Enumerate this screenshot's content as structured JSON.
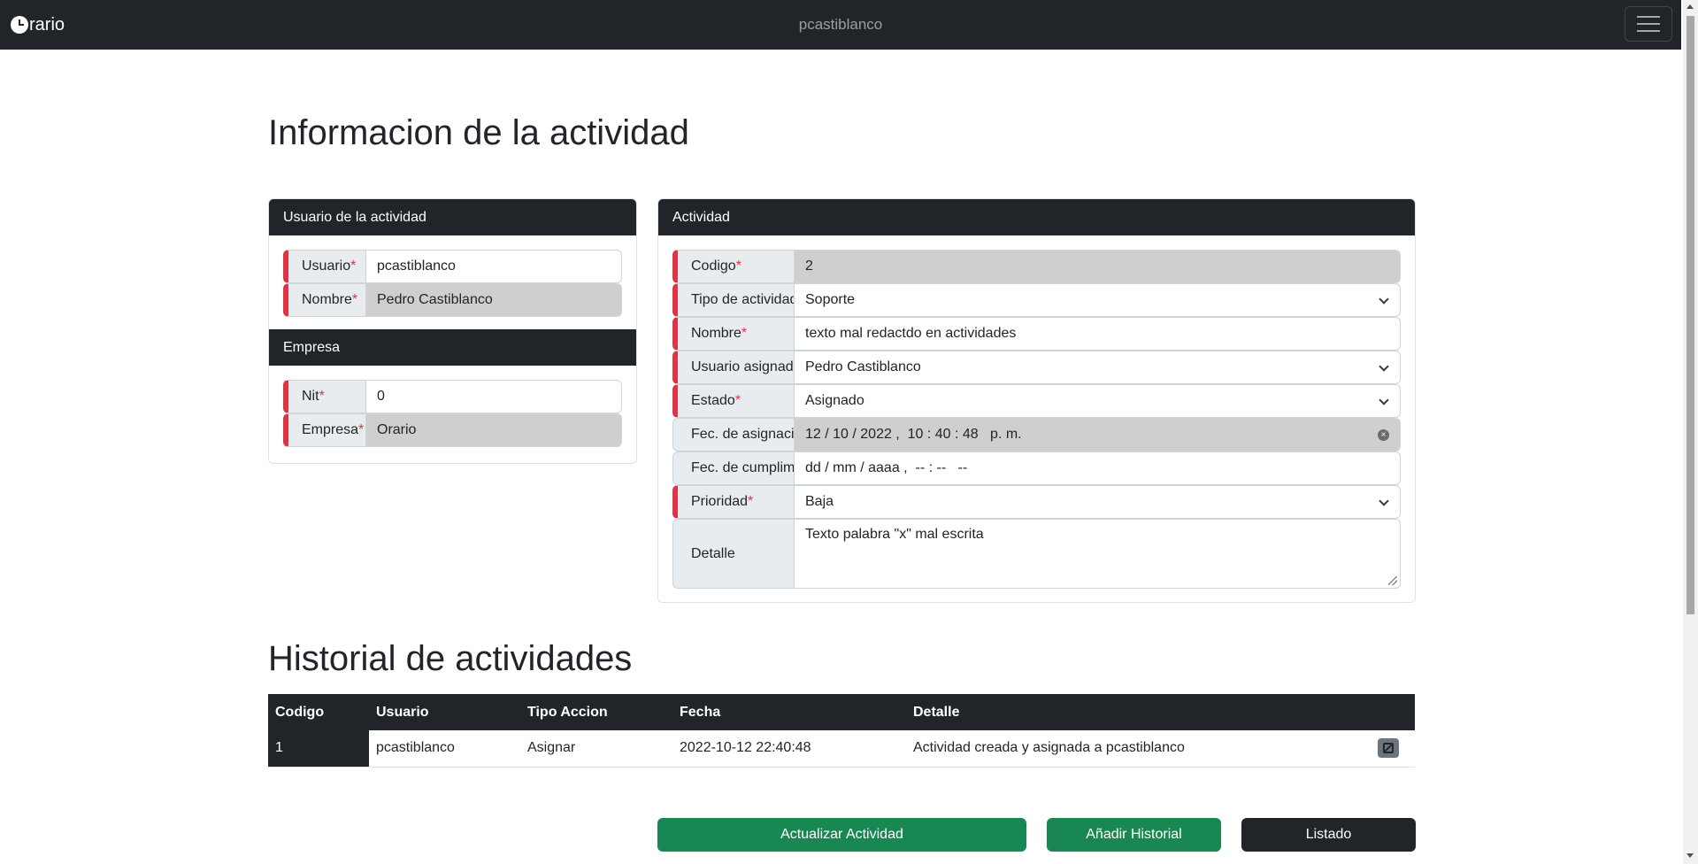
{
  "navbar": {
    "brand_icon": "clock-icon",
    "brand_text": "rario",
    "user": "pcastiblanco",
    "menu_icon": "hamburger-menu-icon"
  },
  "page": {
    "title": "Informacion de la actividad",
    "history_title": "Historial de actividades"
  },
  "user_card": {
    "header": "Usuario de la actividad",
    "usuario_label": "Usuario",
    "usuario_value": "pcastiblanco",
    "nombre_label": "Nombre",
    "nombre_value": "Pedro Castiblanco"
  },
  "company_card": {
    "header": "Empresa",
    "nit_label": "Nit",
    "nit_value": "0",
    "empresa_label": "Empresa",
    "empresa_value": "Orario"
  },
  "activity_card": {
    "header": "Actividad",
    "codigo_label": "Codigo",
    "codigo_value": "2",
    "tipo_label": "Tipo de actividad",
    "tipo_value": "Soporte",
    "nombre_label": "Nombre",
    "nombre_value": "texto mal redactdo en actividades",
    "usuario_label": "Usuario asignado",
    "usuario_value": "Pedro Castiblanco",
    "estado_label": "Estado",
    "estado_value": "Asignado",
    "fec_asig_label": "Fec. de asignacion",
    "fec_asig_value": "12 / 10 / 2022 ,  10 : 40 : 48   p. m.",
    "fec_cump_label": "Fec. de cumplimiento",
    "fec_cump_value": "dd / mm / aaaa ,  -- : --   --",
    "prioridad_label": "Prioridad",
    "prioridad_value": "Baja",
    "detalle_label": "Detalle",
    "detalle_value": "Texto palabra \"x\" mal escrita",
    "required_mark": "*"
  },
  "history_table": {
    "headers": [
      "Codigo",
      "Usuario",
      "Tipo Accion",
      "Fecha",
      "Detalle"
    ],
    "rows": [
      {
        "codigo": "1",
        "usuario": "pcastiblanco",
        "tipo": "Asignar",
        "fecha": "2022-10-12 22:40:48",
        "detalle": "Actividad creada y asignada a pcastiblanco"
      }
    ]
  },
  "buttons": {
    "update": "Actualizar Actividad",
    "add_history": "Añadir Historial",
    "list": "Listado"
  },
  "colors": {
    "dark": "#212529",
    "required": "#dc3545",
    "success": "#198754",
    "readonly": "#cfcfcf"
  }
}
